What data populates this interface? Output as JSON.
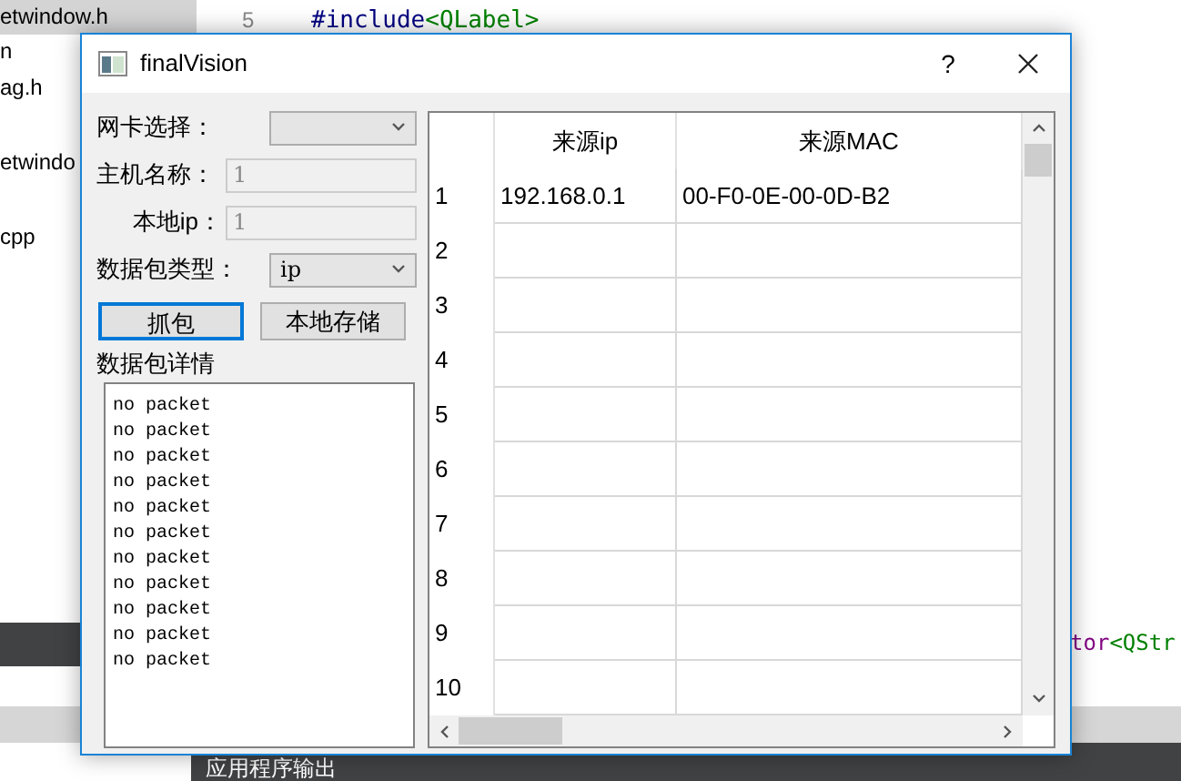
{
  "ide": {
    "files": [
      {
        "label": "etwindow.h",
        "selected": true
      },
      {
        "label": "n",
        "selected": false
      },
      {
        "label": "ag.h",
        "selected": false
      },
      {
        "label": "etwindo",
        "selected": false
      },
      {
        "label": "cpp",
        "selected": false
      }
    ],
    "line_number": "5",
    "code_line": {
      "keyword": "#include",
      "header": "<QLabel>"
    },
    "code_fragment": {
      "name": "tor",
      "template": "<QStr"
    },
    "output_tab": "应用程序输出"
  },
  "window": {
    "title": "finalVision",
    "help": "?"
  },
  "form": {
    "fields": [
      {
        "kind": "combo",
        "label": "网卡选择："
      },
      {
        "kind": "input",
        "label": "主机名称：",
        "placeholder": "1"
      },
      {
        "kind": "input",
        "label": "本地ip：",
        "placeholder": "1"
      },
      {
        "kind": "combo",
        "label": "数据包类型：",
        "value": "ip"
      }
    ],
    "buttons": [
      {
        "label": "抓包",
        "focused": true
      },
      {
        "label": "本地存储",
        "focused": false
      }
    ],
    "details_label": "数据包详情",
    "details": [
      "no packet",
      "no packet",
      "no packet",
      "no packet",
      "no packet",
      "no packet",
      "no packet",
      "no packet",
      "no packet",
      "no packet",
      "no packet"
    ]
  },
  "table": {
    "columns": [
      "来源ip",
      "来源MAC"
    ],
    "rows": [
      {
        "header": "1",
        "cells": [
          "192.168.0.1",
          "00-F0-0E-00-0D-B2"
        ]
      },
      {
        "header": "2",
        "cells": []
      },
      {
        "header": "3",
        "cells": []
      },
      {
        "header": "4",
        "cells": []
      },
      {
        "header": "5",
        "cells": []
      },
      {
        "header": "6",
        "cells": []
      },
      {
        "header": "7",
        "cells": []
      },
      {
        "header": "8",
        "cells": []
      },
      {
        "header": "9",
        "cells": []
      },
      {
        "header": "10",
        "cells": []
      }
    ]
  }
}
